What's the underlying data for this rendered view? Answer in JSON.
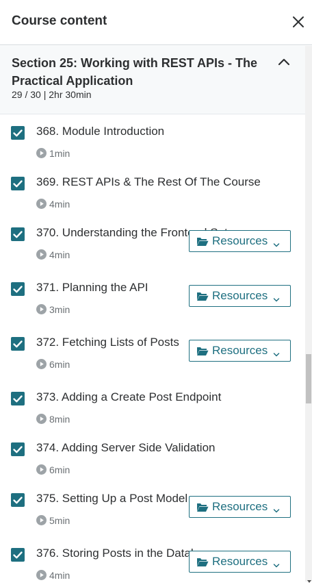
{
  "header": {
    "title": "Course content"
  },
  "section": {
    "title": "Section 25: Working with REST APIs - The Practical Application",
    "progress": "29 / 30",
    "separator": "|",
    "duration": "2hr 30min"
  },
  "resources_label": "Resources",
  "lectures": [
    {
      "title": "368. Module Introduction",
      "duration": "1min",
      "completed": true,
      "has_resources": false
    },
    {
      "title": "369. REST APIs & The Rest Of The Course",
      "duration": "4min",
      "completed": true,
      "has_resources": false
    },
    {
      "title": "370. Understanding the Frontend Setup",
      "duration": "4min",
      "completed": true,
      "has_resources": true
    },
    {
      "title": "371. Planning the API",
      "duration": "3min",
      "completed": true,
      "has_resources": true
    },
    {
      "title": "372. Fetching Lists of Posts",
      "duration": "6min",
      "completed": true,
      "has_resources": true
    },
    {
      "title": "373. Adding a Create Post Endpoint",
      "duration": "8min",
      "completed": true,
      "has_resources": false
    },
    {
      "title": "374. Adding Server Side Validation",
      "duration": "6min",
      "completed": true,
      "has_resources": false
    },
    {
      "title": "375. Setting Up a Post Model",
      "duration": "5min",
      "completed": true,
      "has_resources": true
    },
    {
      "title": "376. Storing Posts in the Database",
      "duration": "4min",
      "completed": true,
      "has_resources": true
    }
  ],
  "colors": {
    "accent": "#1e6f80",
    "text": "#2d2f31",
    "muted": "#6a6f73",
    "section_bg": "#f7f9fa"
  }
}
